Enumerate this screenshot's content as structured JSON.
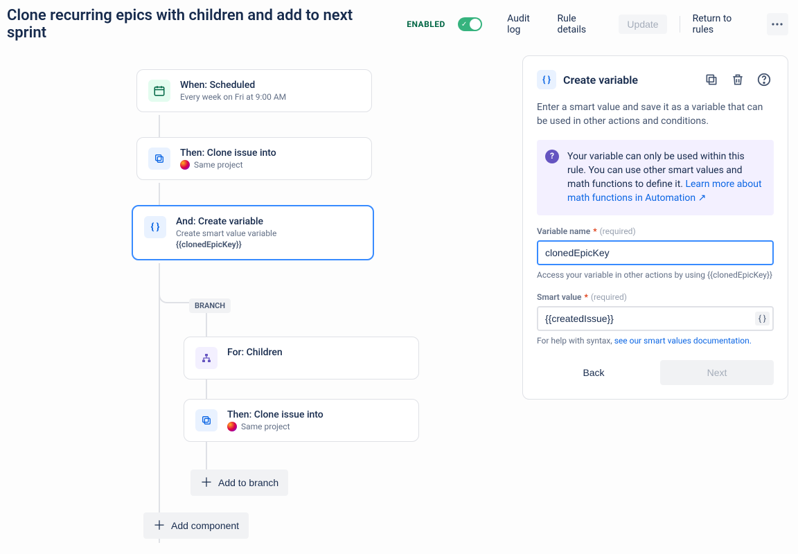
{
  "header": {
    "title": "Clone recurring epics with children and add to next sprint",
    "enabled_badge": "ENABLED",
    "links": {
      "audit": "Audit log",
      "details": "Rule details",
      "update": "Update",
      "return": "Return to rules"
    }
  },
  "flow": {
    "trigger": {
      "title": "When: Scheduled",
      "sub": "Every week on Fri at 9:00 AM"
    },
    "clone1": {
      "title": "Then: Clone issue into",
      "sub": "Same project"
    },
    "createvar": {
      "title": "And: Create variable",
      "sub1": "Create smart value variable",
      "sub2": "{{clonedEpicKey}}"
    },
    "branch_label": "BRANCH",
    "branch_for": {
      "title": "For: Children"
    },
    "clone2": {
      "title": "Then: Clone issue into",
      "sub": "Same project"
    },
    "add_branch": "Add to branch",
    "add_component": "Add component"
  },
  "panel": {
    "title": "Create variable",
    "desc": "Enter a smart value and save it as a variable that can be used in other actions and conditions.",
    "info_text": "Your variable can only be used within this rule. You can use other smart values and math functions to define it. ",
    "info_link": "Learn more about math functions in Automation ↗",
    "varname": {
      "label": "Variable name",
      "required": "(required)",
      "value": "clonedEpicKey",
      "help": "Access your variable in other actions by using {{clonedEpicKey}}"
    },
    "smartval": {
      "label": "Smart value",
      "required": "(required)",
      "value": "{{createdIssue}}",
      "help_prefix": "For help with syntax, ",
      "help_link": "see our smart values documentation."
    },
    "back": "Back",
    "next": "Next"
  }
}
